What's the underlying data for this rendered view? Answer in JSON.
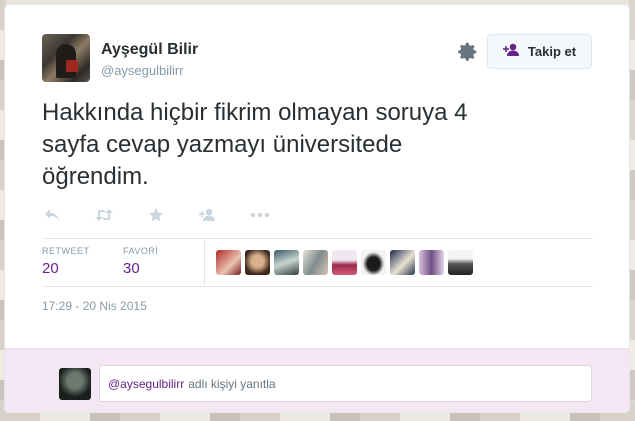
{
  "user": {
    "name": "Ayşegül Bilir",
    "handle": "@aysegulbilirr"
  },
  "follow_button": {
    "label": "Takip et"
  },
  "tweet": {
    "lines": [
      "Hakkında hiçbir fikrim olmayan soruya 4",
      "sayfa cevap yazmayı üniversitede",
      "öğrendim."
    ]
  },
  "actions": [
    "reply-icon",
    "retweet-icon",
    "favorite-icon",
    "follow-icon",
    "more-icon"
  ],
  "stats": {
    "retweet_label": "RETWEET",
    "retweet_count": "20",
    "favorite_label": "FAVORİ",
    "favorite_count": "30"
  },
  "timestamp": "17:29 - 20 Nis 2015",
  "reply": {
    "mention": "@aysegulbilirr",
    "rest": "adlı kişiyi yanıtla"
  },
  "colors": {
    "accent": "#66248a",
    "muted": "#8899a6",
    "text": "#292f33",
    "reply_bg": "#f5e6f3"
  }
}
